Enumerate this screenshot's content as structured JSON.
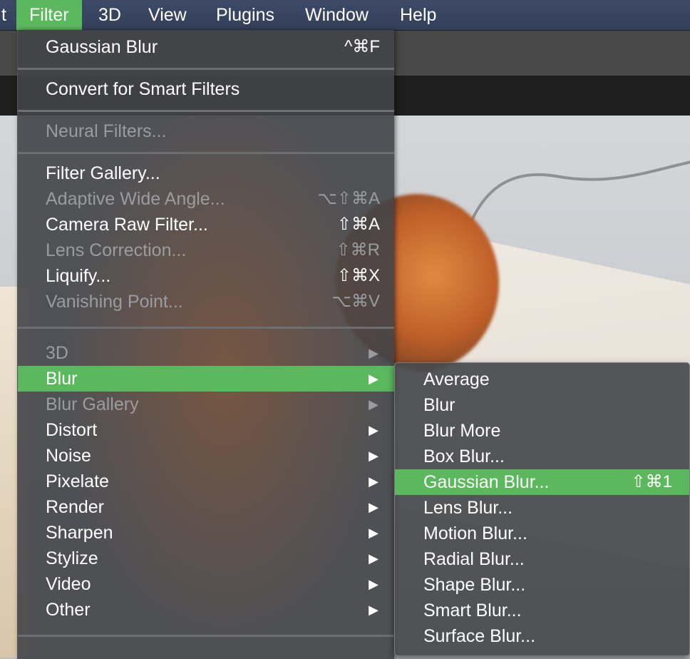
{
  "menubar": {
    "items": [
      {
        "label": "t"
      },
      {
        "label": "Filter"
      },
      {
        "label": "3D"
      },
      {
        "label": "View"
      },
      {
        "label": "Plugins"
      },
      {
        "label": "Window"
      },
      {
        "label": "Help"
      }
    ]
  },
  "filter_menu": {
    "last_filter": {
      "label": "Gaussian Blur",
      "shortcut": "^⌘F"
    },
    "convert": {
      "label": "Convert for Smart Filters"
    },
    "neural": {
      "label": "Neural Filters..."
    },
    "group1": [
      {
        "label": "Filter Gallery...",
        "shortcut": ""
      },
      {
        "label": "Adaptive Wide Angle...",
        "shortcut": "⌥⇧⌘A"
      },
      {
        "label": "Camera Raw Filter...",
        "shortcut": "⇧⌘A"
      },
      {
        "label": "Lens Correction...",
        "shortcut": "⇧⌘R"
      },
      {
        "label": "Liquify...",
        "shortcut": "⇧⌘X"
      },
      {
        "label": "Vanishing Point...",
        "shortcut": "⌥⌘V"
      }
    ],
    "submenus": [
      {
        "label": "3D"
      },
      {
        "label": "Blur"
      },
      {
        "label": "Blur Gallery"
      },
      {
        "label": "Distort"
      },
      {
        "label": "Noise"
      },
      {
        "label": "Pixelate"
      },
      {
        "label": "Render"
      },
      {
        "label": "Sharpen"
      },
      {
        "label": "Stylize"
      },
      {
        "label": "Video"
      },
      {
        "label": "Other"
      }
    ],
    "arrow": "▶"
  },
  "blur_submenu": {
    "items": [
      {
        "label": "Average",
        "shortcut": ""
      },
      {
        "label": "Blur",
        "shortcut": ""
      },
      {
        "label": "Blur More",
        "shortcut": ""
      },
      {
        "label": "Box Blur...",
        "shortcut": ""
      },
      {
        "label": "Gaussian Blur...",
        "shortcut": "⇧⌘1"
      },
      {
        "label": "Lens Blur...",
        "shortcut": ""
      },
      {
        "label": "Motion Blur...",
        "shortcut": ""
      },
      {
        "label": "Radial Blur...",
        "shortcut": ""
      },
      {
        "label": "Shape Blur...",
        "shortcut": ""
      },
      {
        "label": "Smart Blur...",
        "shortcut": ""
      },
      {
        "label": "Surface Blur...",
        "shortcut": ""
      }
    ]
  },
  "colors": {
    "highlight": "#5cb85c",
    "menubar": "#3a465f",
    "menu_bg": "#424448",
    "disabled_text": "#9a9ca0"
  }
}
